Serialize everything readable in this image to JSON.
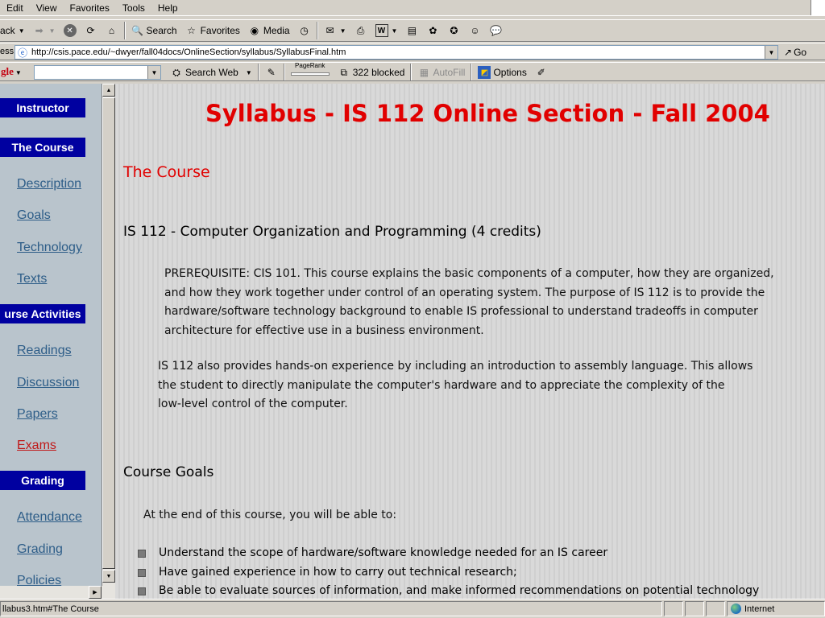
{
  "menu": {
    "items": [
      "Edit",
      "View",
      "Favorites",
      "Tools",
      "Help"
    ]
  },
  "toolbar": {
    "back_label": "ack",
    "search_label": "Search",
    "favorites_label": "Favorites",
    "media_label": "Media"
  },
  "address": {
    "label": "ess",
    "url": "http://csis.pace.edu/~dwyer/fall04docs/OnlineSection/syllabus/SyllabusFinal.htm",
    "go_label": "Go"
  },
  "google": {
    "label": "gle",
    "search_value": "",
    "search_web_label": "Search Web",
    "pagerank_label": "PageRank",
    "blocked_label": "322 blocked",
    "autofill_label": "AutoFill",
    "options_label": "Options"
  },
  "sidebar": {
    "sections": [
      {
        "label": "Instructor"
      },
      {
        "label": "The Course"
      },
      {
        "label": "urse Activities"
      },
      {
        "label": "Grading"
      }
    ],
    "links": [
      {
        "label": "Description"
      },
      {
        "label": "Goals"
      },
      {
        "label": "Technology"
      },
      {
        "label": "Texts"
      },
      {
        "label": "Readings"
      },
      {
        "label": "Discussion"
      },
      {
        "label": "Papers"
      },
      {
        "label": "Exams"
      },
      {
        "label": "Attendance"
      },
      {
        "label": "Grading"
      },
      {
        "label": "Policies"
      }
    ]
  },
  "content": {
    "title": "Syllabus - IS 112 Online Section - Fall 2004",
    "section_heading": "The Course",
    "course_heading": "IS 112 - Computer Organization and Programming (4 credits)",
    "prereq": [
      "PREREQUISITE: CIS 101. This course explains the basic components of a computer, how they are organized,",
      "and how they work together under control of an operating system. The purpose of IS 112 is to provide the",
      "hardware/software technology background to enable IS professional to understand tradeoffs in computer",
      "architecture for effective use in a business environment."
    ],
    "handson": [
      "IS 112 also provides hands-on experience by including an introduction to assembly language. This allows",
      "the student to directly manipulate the computer's hardware and to appreciate the complexity of the",
      "low-level control of the computer."
    ],
    "goals_heading": "Course Goals",
    "goals_intro": "At the end of this course, you will be able to:",
    "goals": [
      "Understand the scope of hardware/software knowledge needed for an IS career",
      "Have gained experience in how to carry out technical research;",
      "Be able to evaluate sources of information, and make informed recommendations on potential technology"
    ]
  },
  "status": {
    "text": "llabus3.htm#The Course",
    "zone_label": "Internet"
  }
}
